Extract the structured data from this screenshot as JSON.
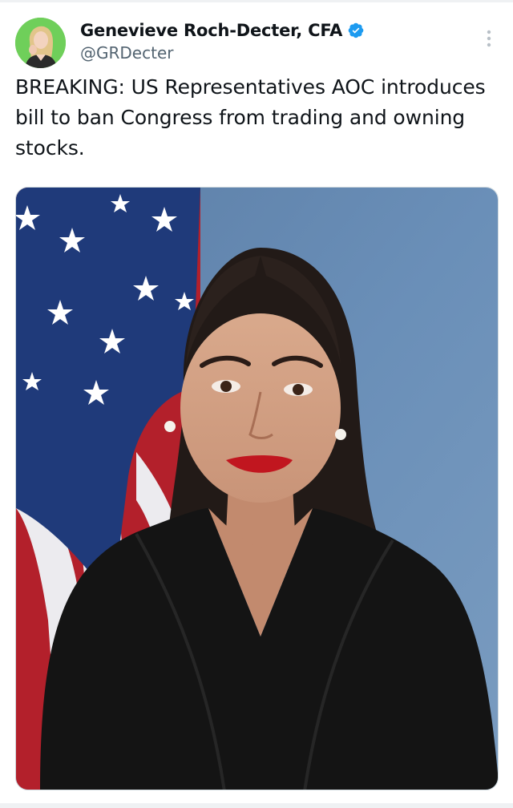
{
  "author": {
    "display_name": "Genevieve Roch-Decter, CFA",
    "handle": "@GRDecter",
    "verified": true,
    "avatar_icon": "profile-photo-avatar",
    "verified_icon": "verified-badge-icon"
  },
  "tweet": {
    "text": "BREAKING: US Representatives AOC introduces bill to ban Congress from trading and owning stocks.",
    "more_icon": "more-vertical-icon"
  },
  "media": {
    "kind": "photo",
    "subject": "portrait-photo"
  },
  "colors": {
    "verified_blue": "#1d9bf0",
    "handle_gray": "#536471",
    "text": "#0f1419",
    "avatar_bg": "#6fcf5a"
  }
}
